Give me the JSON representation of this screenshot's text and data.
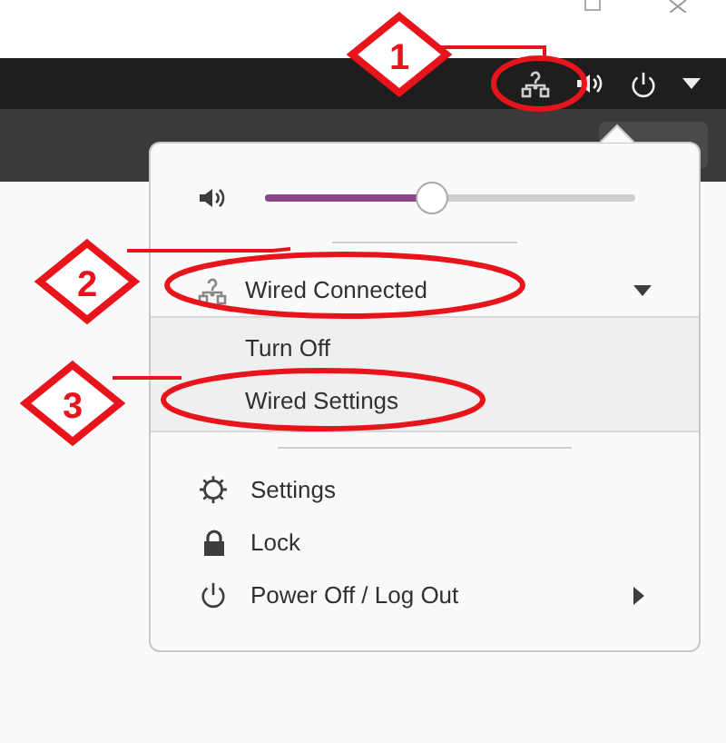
{
  "annotations": [
    {
      "number": "1"
    },
    {
      "number": "2"
    },
    {
      "number": "3"
    }
  ],
  "menu": {
    "volume": {
      "level": 0.45
    },
    "network": {
      "label": "Wired Connected",
      "expanded": true,
      "items": [
        "Turn Off",
        "Wired Settings"
      ]
    },
    "items": [
      {
        "kind": "settings",
        "label": "Settings",
        "submenu": false
      },
      {
        "kind": "lock",
        "label": "Lock",
        "submenu": false
      },
      {
        "kind": "power",
        "label": "Power Off / Log Out",
        "submenu": true
      }
    ]
  }
}
